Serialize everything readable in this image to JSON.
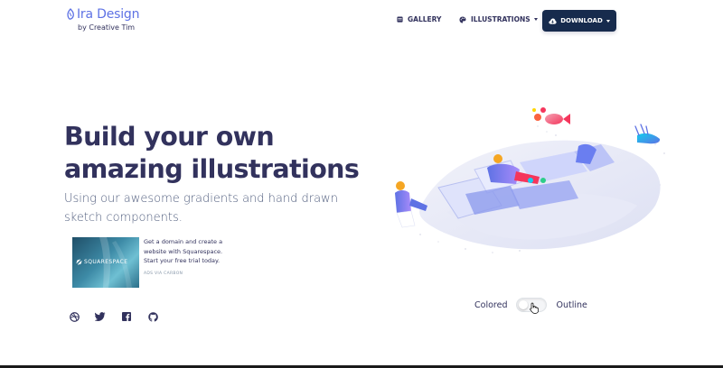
{
  "navbar": {
    "brand_title": "Ira Design",
    "brand_subtitle": "by Creative Tim",
    "gallery_label": "GALLERY",
    "illustrations_label": "ILLUSTRATIONS",
    "download_label": "DOWNLOAD",
    "icons": [
      "logo-icon",
      "gallery-icon",
      "palette-icon",
      "cloud-download-icon"
    ]
  },
  "hero": {
    "title": "Build your own amazing illustrations",
    "lead": "Using our awesome gradients and hand drawn sketch components."
  },
  "ad": {
    "image_text": "SQUARESPACE",
    "text": "Get a domain and create a website with Squarespace. Start your free trial today.",
    "via": "ADS VIA CARBON"
  },
  "socials": {
    "icons": [
      "dribbble-icon",
      "twitter-icon",
      "facebook-icon",
      "github-icon"
    ]
  },
  "toggle": {
    "left_label": "Colored",
    "right_label": "Outline",
    "state": "off"
  },
  "colors": {
    "primary": "#5e72e4",
    "dark": "#172b4d",
    "text": "#32325d",
    "muted": "#525f7f"
  }
}
